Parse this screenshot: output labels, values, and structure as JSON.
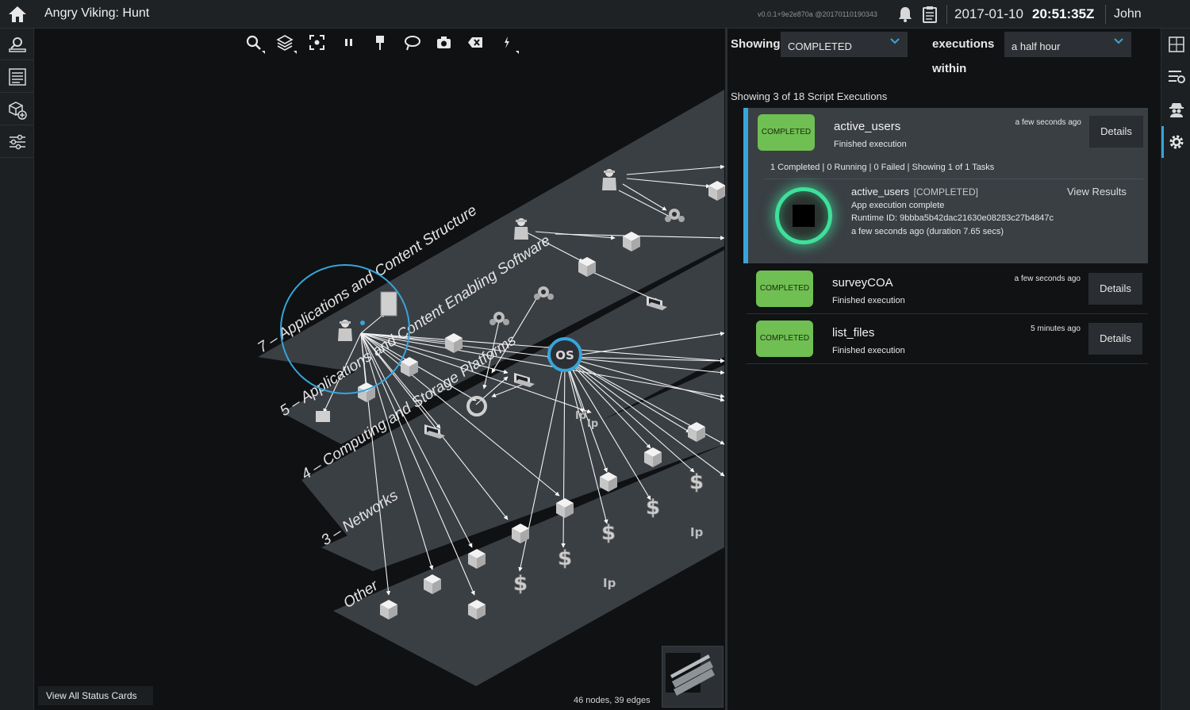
{
  "app": {
    "title": "Angry Viking: Hunt",
    "version": "v0.0.1+9e2e870a @20170110190343",
    "date": "2017-01-10",
    "time": "20:51:35Z",
    "user": "John"
  },
  "graph": {
    "layers": [
      "7 – Applications and Content Structure",
      "5 – Applications and Content Enabling Software",
      "4 – Computing and Storage Platforms",
      "3 – Networks",
      "Other"
    ],
    "stats": "46 nodes, 39 edges",
    "status_cards_label": "View All Status Cards",
    "os_label": "OS"
  },
  "filter": {
    "showing_label": "Showing",
    "status_value": "COMPLETED",
    "executions_label": "executions",
    "within_label": "within",
    "period_value": "a half hour",
    "count_text": "Showing 3 of 18 Script Executions"
  },
  "executions": [
    {
      "status": "COMPLETED",
      "name": "active_users",
      "subtitle": "Finished execution",
      "age": "a few seconds ago",
      "details_label": "Details",
      "task_summary": "1 Completed | 0 Running | 0 Failed | Showing 1 of 1 Tasks",
      "task": {
        "name": "active_users",
        "status": "[COMPLETED]",
        "line1": "App execution complete",
        "line2": "Runtime ID: 9bbba5b42dac21630e08283c27b4847c",
        "line3": "a few seconds ago (duration 7.65 secs)",
        "view_results_label": "View Results"
      }
    },
    {
      "status": "COMPLETED",
      "name": "surveyCOA",
      "subtitle": "Finished execution",
      "age": "a few seconds ago",
      "details_label": "Details"
    },
    {
      "status": "COMPLETED",
      "name": "list_files",
      "subtitle": "Finished execution",
      "age": "5 minutes ago",
      "details_label": "Details"
    }
  ],
  "icons": {
    "topbar": [
      "home-icon",
      "bell-icon",
      "clipboard-icon"
    ],
    "left_sidebar": [
      "search-list-icon",
      "list-icon",
      "cube-add-icon",
      "sliders-icon"
    ],
    "toolbar": [
      "search-icon",
      "layers-icon",
      "focus-icon",
      "pause-icon",
      "pin-icon",
      "lasso-icon",
      "camera-icon",
      "clear-icon",
      "lightning-icon"
    ],
    "right_sidebar": [
      "frame-icon",
      "list-settings-icon",
      "spy-icon",
      "gear-icon"
    ]
  },
  "colors": {
    "accent": "#37a5db",
    "completed_badge": "#6fbf52",
    "running_glow": "#3fe09a",
    "background": "#101214"
  }
}
